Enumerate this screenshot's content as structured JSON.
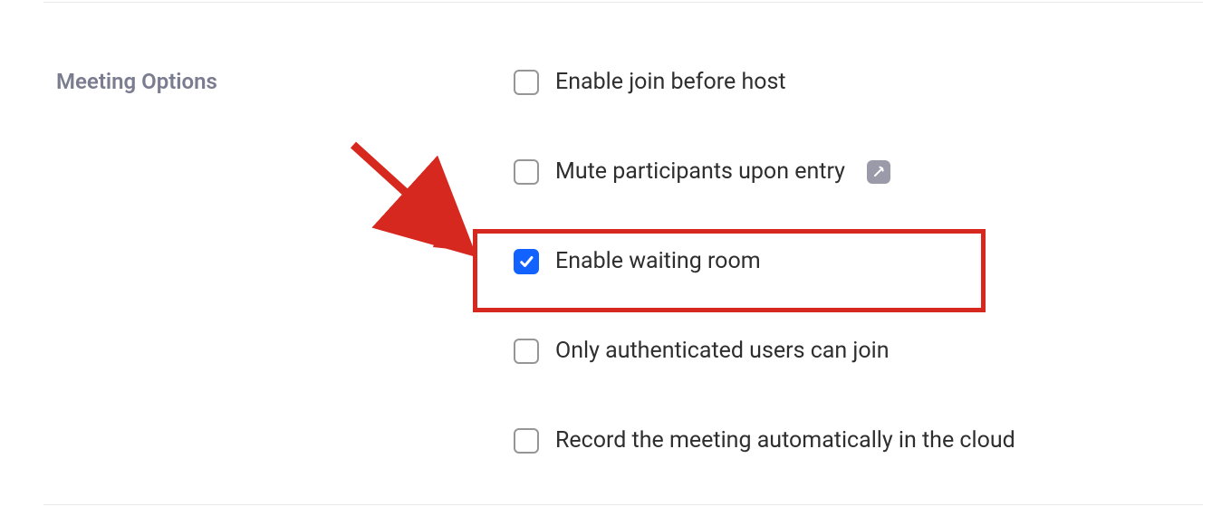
{
  "section": {
    "title": "Meeting Options"
  },
  "options": [
    {
      "label": "Enable join before host",
      "checked": false,
      "hasInfo": false
    },
    {
      "label": "Mute participants upon entry",
      "checked": false,
      "hasInfo": true
    },
    {
      "label": "Enable waiting room",
      "checked": true,
      "hasInfo": false
    },
    {
      "label": "Only authenticated users can join",
      "checked": false,
      "hasInfo": false
    },
    {
      "label": "Record the meeting automatically in the cloud",
      "checked": false,
      "hasInfo": false
    }
  ],
  "colors": {
    "accent": "#1162ff",
    "highlight": "#d6281f"
  }
}
